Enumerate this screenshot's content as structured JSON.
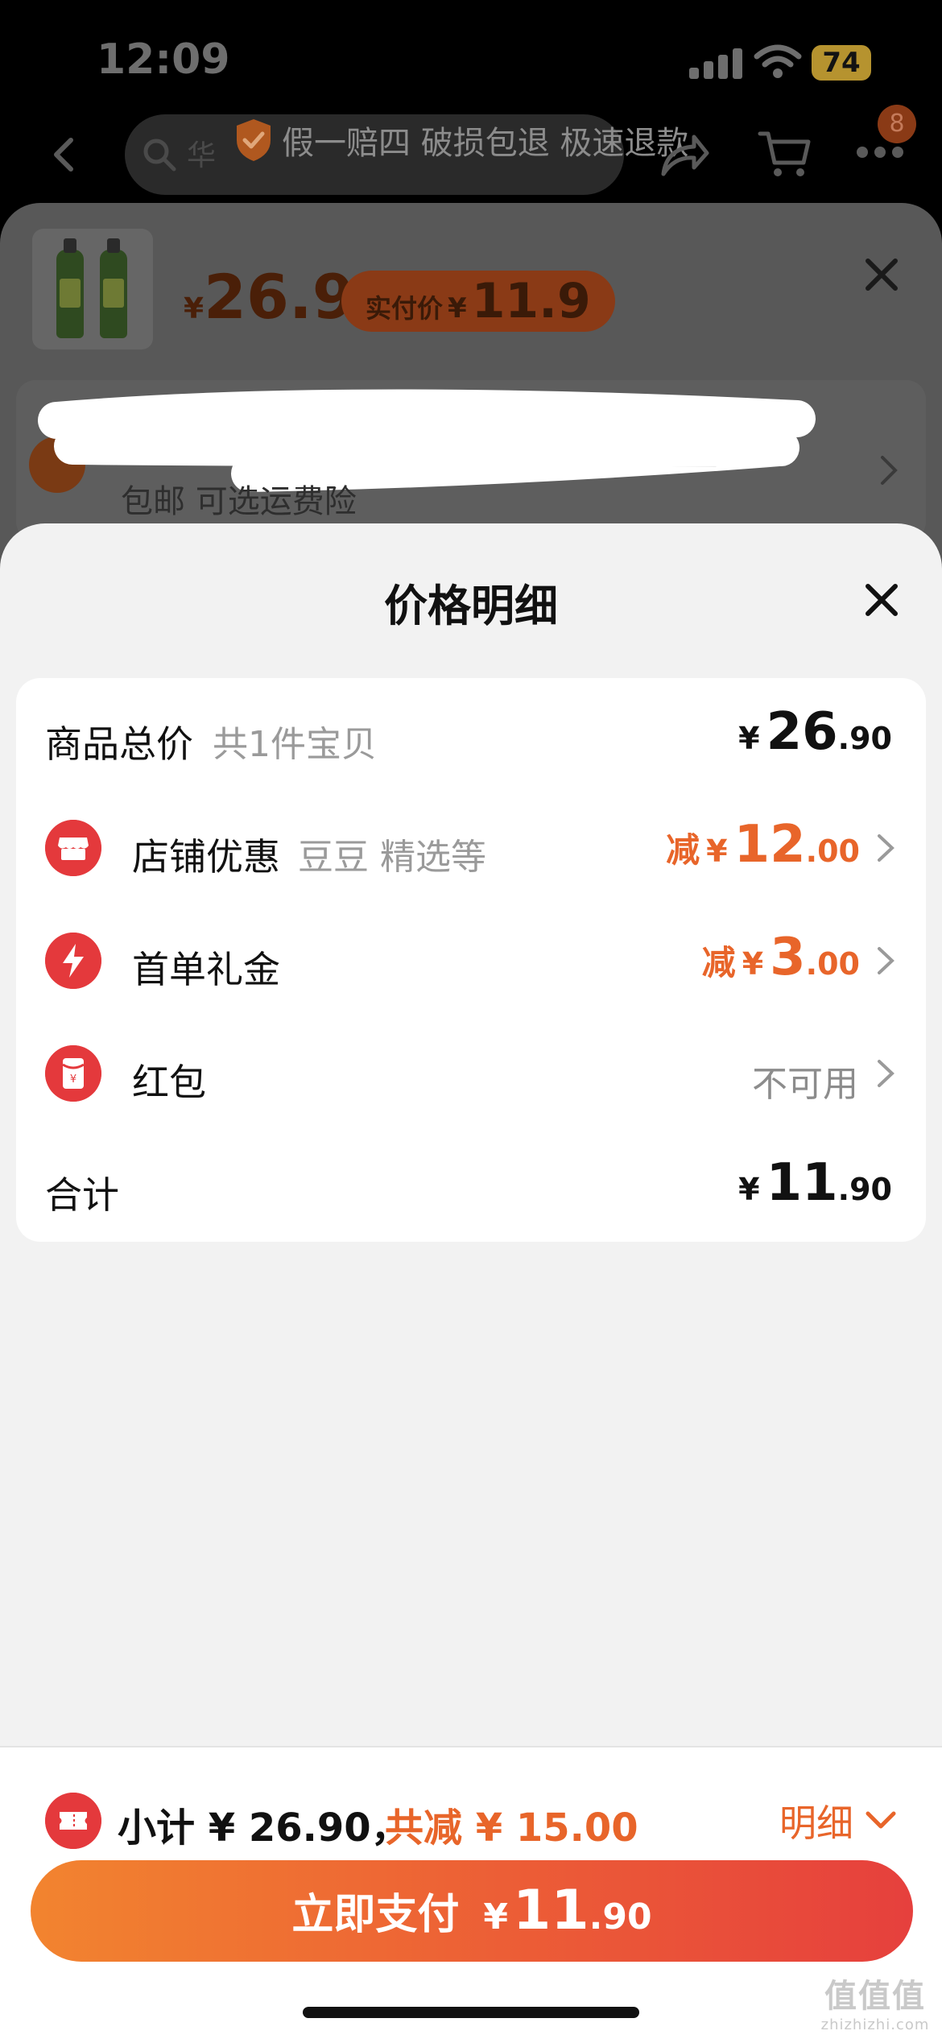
{
  "status_bar": {
    "time": "12:09",
    "battery": "74"
  },
  "top_nav": {
    "search_hint": "华",
    "guarantee": "假一赔四 破损包退 极速退款",
    "cart_badge": "8"
  },
  "product_sheet": {
    "price_yen": "¥",
    "price": "26.9",
    "paid_label": "实付价",
    "paid_yen": "¥",
    "paid_price": "11.9",
    "shipping": "包邮  可选运费险"
  },
  "price_detail": {
    "title": "价格明细",
    "rows": [
      {
        "label": "商品总价",
        "sub": "共1件宝贝",
        "prefix": "",
        "yen": "¥",
        "int": "26",
        "dec": ".90"
      },
      {
        "label": "店铺优惠",
        "sub": "豆豆 精选等",
        "prefix": "减",
        "yen": "¥",
        "int": "12",
        "dec": ".00"
      },
      {
        "label": "首单礼金",
        "sub": "",
        "prefix": "减",
        "yen": "¥",
        "int": "3",
        "dec": ".00"
      },
      {
        "label": "红包",
        "sub": "",
        "status": "不可用"
      },
      {
        "label": "合计",
        "sub": "",
        "prefix": "",
        "yen": "¥",
        "int": "11",
        "dec": ".90"
      }
    ]
  },
  "bottom_bar": {
    "subtotal": "小计 ¥ 26.90，",
    "saved": "共减 ¥ 15.00",
    "detail_label": "明细",
    "pay_label": "立即支付",
    "pay_yen": "¥",
    "pay_int": "11",
    "pay_dec": ".90"
  },
  "watermark": {
    "top": "值值值",
    "bottom": "zhizhizhi.com"
  },
  "colors": {
    "accent": "#e8652a",
    "icon_red": "#e4393c",
    "sheet_bg": "#f2f2f2",
    "pay_gradient_start": "#f2842f",
    "pay_gradient_end": "#e6403d"
  },
  "icons": [
    "back-icon",
    "search-icon",
    "shield-icon",
    "share-icon",
    "cart-icon",
    "more-icon",
    "close-icon",
    "store-icon",
    "lightning-icon",
    "red-packet-icon",
    "chevron-right-icon",
    "coupon-icon",
    "chevron-down-icon"
  ]
}
